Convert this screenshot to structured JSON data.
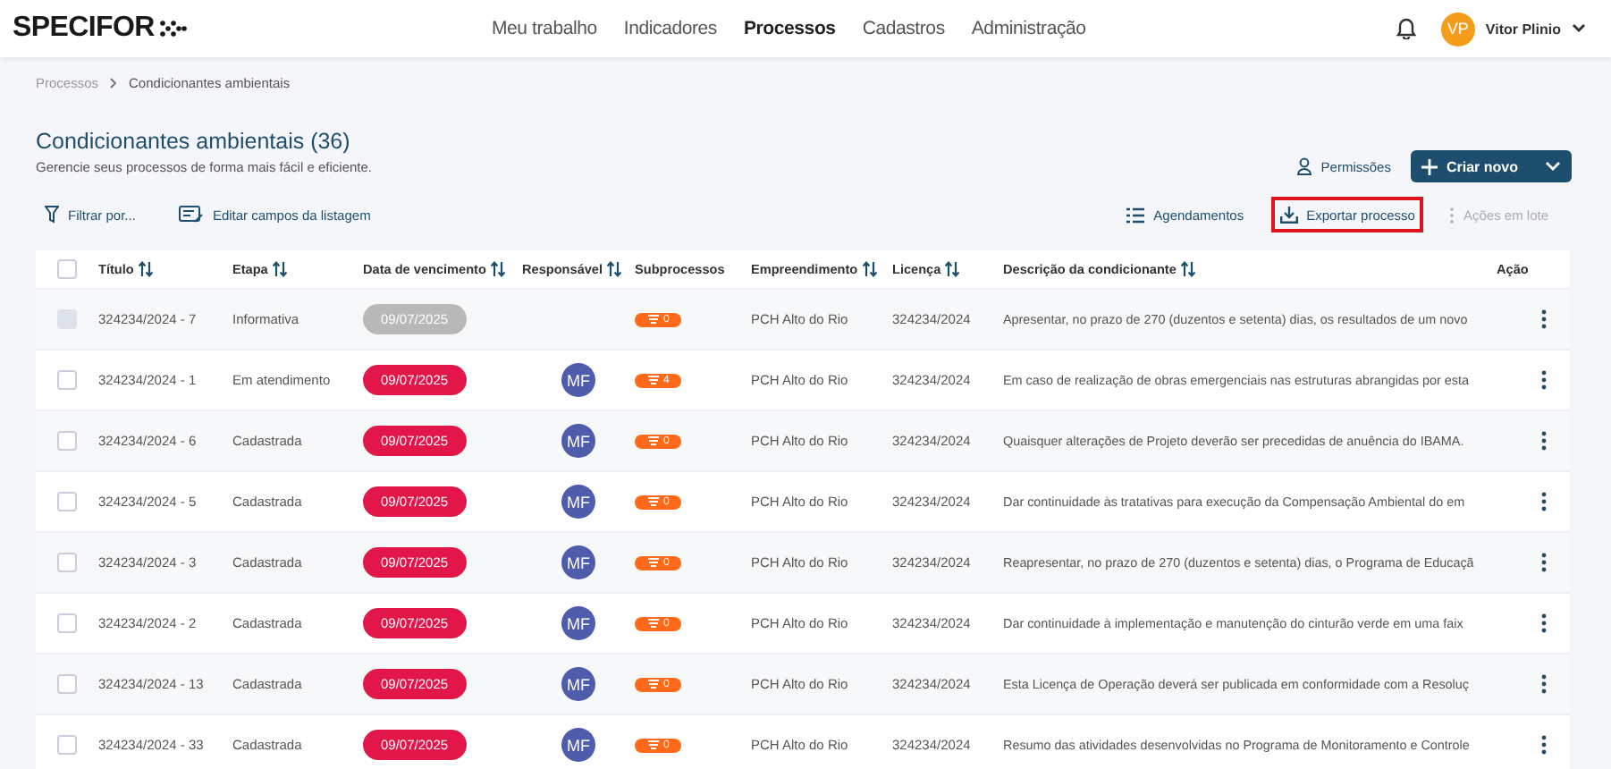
{
  "brand": "SPECIFOR",
  "nav": [
    {
      "label": "Meu trabalho",
      "selected": false
    },
    {
      "label": "Indicadores",
      "selected": false
    },
    {
      "label": "Processos",
      "selected": true
    },
    {
      "label": "Cadastros",
      "selected": false
    },
    {
      "label": "Administração",
      "selected": false
    }
  ],
  "user": {
    "initials": "VP",
    "name": "Vitor Plinio"
  },
  "breadcrumb": [
    "Processos",
    "Condicionantes ambientais"
  ],
  "title": "Condicionantes ambientais (36)",
  "subtitle": "Gerencie seus processos de forma mais fácil e eficiente.",
  "header_actions": {
    "permissions": "Permissões",
    "create": "Criar novo"
  },
  "toolbar_left": [
    "Filtrar por...",
    "Editar campos da listagem"
  ],
  "toolbar_right": [
    {
      "kind": "schedule",
      "label": "Agendamentos",
      "disabled": false,
      "highlighted": false
    },
    {
      "kind": "export",
      "label": "Exportar processo",
      "disabled": false,
      "highlighted": true
    },
    {
      "kind": "batch",
      "label": "Ações em lote",
      "disabled": true,
      "highlighted": false
    }
  ],
  "select_all": {
    "checked": false
  },
  "columns": [
    {
      "label": "Título",
      "sortable": true
    },
    {
      "label": "Etapa",
      "sortable": true
    },
    {
      "label": "Data de vencimento",
      "sortable": true
    },
    {
      "label": "Responsável",
      "sortable": true
    },
    {
      "label": "Subprocessos",
      "sortable": false
    },
    {
      "label": "Empreendimento",
      "sortable": true
    },
    {
      "label": "Licença",
      "sortable": true
    },
    {
      "label": "Descrição da condicionante",
      "sortable": true
    },
    {
      "label": "Ação",
      "sortable": false
    }
  ],
  "rows": [
    {
      "title": "324234/2024 - 7",
      "stage": "Informativa",
      "due": "09/07/2025",
      "responsible": "",
      "subprocesses": "0",
      "project": "PCH Alto do Rio",
      "license": "324234/2024",
      "description": "Apresentar, no prazo de 270 (duzentos e setenta) dias, os resultados de um novo",
      "disabled": true
    },
    {
      "title": "324234/2024 - 1",
      "stage": "Em atendimento",
      "due": "09/07/2025",
      "responsible": "MF",
      "subprocesses": "4",
      "project": "PCH Alto do Rio",
      "license": "324234/2024",
      "description": "Em caso de realização de obras emergenciais nas estruturas abrangidas por esta",
      "disabled": false
    },
    {
      "title": "324234/2024 - 6",
      "stage": "Cadastrada",
      "due": "09/07/2025",
      "responsible": "MF",
      "subprocesses": "0",
      "project": "PCH Alto do Rio",
      "license": "324234/2024",
      "description": "Quaisquer alterações de Projeto deverão ser precedidas de anuência do IBAMA.",
      "disabled": false
    },
    {
      "title": "324234/2024 - 5",
      "stage": "Cadastrada",
      "due": "09/07/2025",
      "responsible": "MF",
      "subprocesses": "0",
      "project": "PCH Alto do Rio",
      "license": "324234/2024",
      "description": "Dar continuidade às tratativas para execução da Compensação Ambiental do em",
      "disabled": false
    },
    {
      "title": "324234/2024 - 3",
      "stage": "Cadastrada",
      "due": "09/07/2025",
      "responsible": "MF",
      "subprocesses": "0",
      "project": "PCH Alto do Rio",
      "license": "324234/2024",
      "description": "Reapresentar, no prazo de 270 (duzentos e setenta) dias, o Programa de Educaçã",
      "disabled": false
    },
    {
      "title": "324234/2024 - 2",
      "stage": "Cadastrada",
      "due": "09/07/2025",
      "responsible": "MF",
      "subprocesses": "0",
      "project": "PCH Alto do Rio",
      "license": "324234/2024",
      "description": "Dar continuidade à implementação e manutenção do cinturão verde em uma faix",
      "disabled": false
    },
    {
      "title": "324234/2024 - 13",
      "stage": "Cadastrada",
      "due": "09/07/2025",
      "responsible": "MF",
      "subprocesses": "0",
      "project": "PCH Alto do Rio",
      "license": "324234/2024",
      "description": "Esta Licença de Operação deverá ser publicada em conformidade com a Resoluç",
      "disabled": false
    },
    {
      "title": "324234/2024 - 33",
      "stage": "Cadastrada",
      "due": "09/07/2025",
      "responsible": "MF",
      "subprocesses": "0",
      "project": "PCH Alto do Rio",
      "license": "324234/2024",
      "description": "Resumo das atividades desenvolvidas no Programa de Monitoramento e Controle",
      "disabled": false
    }
  ]
}
